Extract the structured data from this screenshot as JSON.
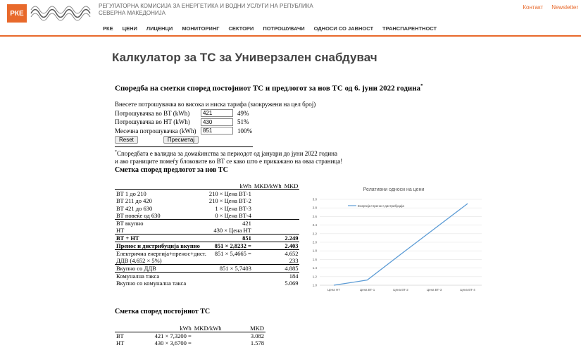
{
  "header": {
    "logo_text": "РКЕ",
    "org_line1": "РЕГУЛАТОРНА КОМИСИЈА ЗА ЕНЕРГЕТИКА И ВОДНИ УСЛУГИ НА РЕПУБЛИКА",
    "org_line2": "СЕВЕРНА МАКЕДОНИЈА",
    "contact": "Контакт",
    "newsletter": "Newsletter",
    "nav": [
      "РКЕ",
      "ЦЕНИ",
      "ЛИЦЕНЦИ",
      "МОНИТОРИНГ",
      "СЕКТОРИ",
      "ПОТРОШУВАЧИ",
      "ОДНОСИ СО ЈАВНОСТ",
      "ТРАНСПАРЕНТНОСТ"
    ]
  },
  "page": {
    "title": "Калкулатор за ТС за Универзален снабдувач",
    "subtitle": "Споредба на сметки според постојниот ТС и предлогот за нов ТС од 6. јуни 2022 година",
    "subtitle_mark": "*"
  },
  "form": {
    "intro": "Внесете потрошувачка во висока и ниска тарифа (заокружени на цел број)",
    "vt_label": "Потрошувачка во ВТ (kWh)",
    "vt_value": "421",
    "vt_pct": "49%",
    "nt_label": "Потрошувачка во НТ (kWh)",
    "nt_value": "430",
    "nt_pct": "51%",
    "month_label": "Месечна потрошувачка (kWh)",
    "month_value": "851",
    "month_pct": "100%",
    "reset": "Reset",
    "calc": "Пресметај"
  },
  "note": {
    "mark": "*",
    "line1": "Споредбата е валидна за домаќинства за периодот од јануари до јуни 2022 година",
    "line2": "и ако границите помеѓу блоковите во ВТ се како што е прикажано на оваа страница!"
  },
  "new_ts": {
    "title": "Сметка според предлогот за нов ТС",
    "headers": [
      "",
      "kWh",
      "MKD/kWh",
      "MKD"
    ],
    "rows": [
      [
        "ВТ 1 до 210",
        "210 × Цена ВТ-1",
        "",
        ""
      ],
      [
        "ВТ 211 до 420",
        "210 × Цена ВТ-2",
        "",
        ""
      ],
      [
        "ВТ 421 до 630",
        "1 × Цена ВТ-3",
        "",
        ""
      ],
      [
        "ВТ повеќе од 630",
        "0 × Цена ВТ-4",
        "",
        ""
      ],
      [
        "ВТ вкупно",
        "421",
        "",
        ""
      ],
      [
        "НТ",
        "430 × Цена НТ",
        "",
        ""
      ],
      [
        "ВТ + НТ",
        "851",
        "",
        "2.249"
      ],
      [
        "Пренос и дистрибуција вкупно",
        "851 × 2,8232 =",
        "",
        "2.403"
      ],
      [
        "Електрична енергија+пренос+дист.",
        "851 × 5,4665 =",
        "",
        "4.652"
      ],
      [
        "ДДВ (4.652 × 5%)",
        "",
        "",
        "233"
      ],
      [
        "Вкупно со ДДВ",
        "851 × 5,7403",
        "",
        "4.885"
      ],
      [
        "Комунална такса",
        "",
        "",
        "184"
      ],
      [
        "Вкупно со комунална такса",
        "",
        "",
        "5.069"
      ]
    ]
  },
  "old_ts": {
    "title": "Сметка според постојниот ТС",
    "headers": [
      "",
      "kWh",
      "MKD/kWh",
      "MKD"
    ],
    "rows": [
      [
        "ВТ",
        "421 × 7,3200 =",
        "",
        "3.082"
      ],
      [
        "НТ",
        "430 × 3,6700 =",
        "",
        "1.578"
      ]
    ]
  },
  "chart_data": {
    "type": "line",
    "title": "Релативни односи на цени",
    "categories": [
      "Цена НТ",
      "Цена ВТ-1",
      "Цена ВТ-2",
      "Цена ВТ-3",
      "Цена ВТ-4"
    ],
    "series": [
      {
        "name": "Енергија+пренос+дистрибуција",
        "values": [
          1.0,
          1.12,
          1.72,
          2.31,
          2.9
        ],
        "color": "#5b9bd5"
      }
    ],
    "ylim": [
      1.0,
      3.0
    ],
    "yticks": [
      "1.0",
      "1.2",
      "1.4",
      "1.6",
      "1.8",
      "2.0",
      "2.2",
      "2.4",
      "2.6",
      "2.8",
      "3.0"
    ],
    "grid": true,
    "legend": "top-left"
  },
  "colors": {
    "accent": "#e8692b"
  }
}
